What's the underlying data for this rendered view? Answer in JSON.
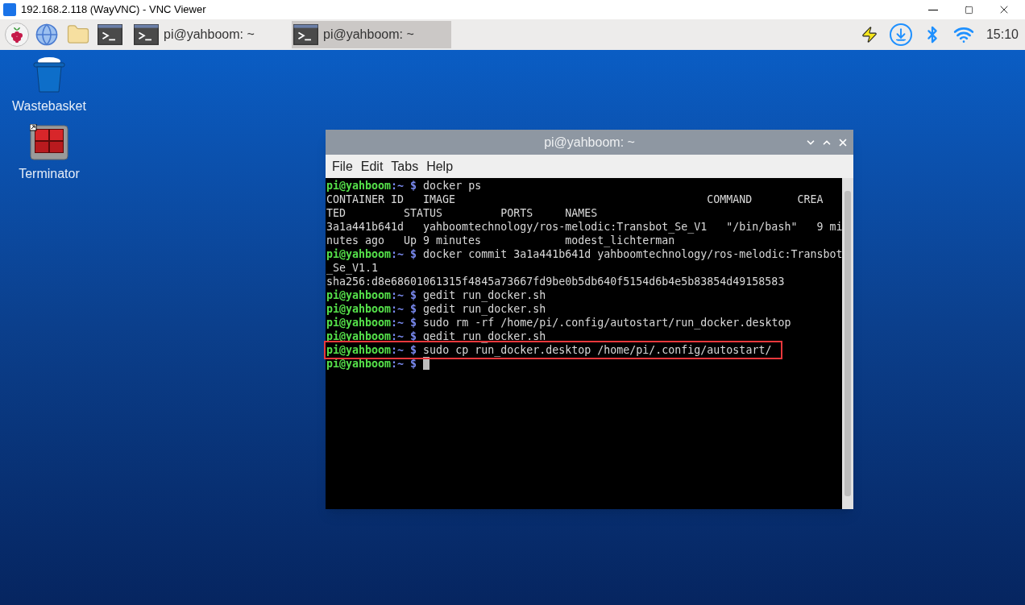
{
  "viewer": {
    "title": "192.168.2.118 (WayVNC) - VNC Viewer"
  },
  "taskbar": {
    "launchers": [
      {
        "kind": "raspberry"
      },
      {
        "kind": "globe"
      },
      {
        "kind": "folder"
      },
      {
        "kind": "terminal"
      }
    ],
    "windows": [
      {
        "label": "pi@yahboom: ~",
        "selected": false
      },
      {
        "label": "pi@yahboom: ~",
        "selected": true
      }
    ],
    "clock": "15:10"
  },
  "desktop_icons": [
    {
      "kind": "wastebasket",
      "label": "Wastebasket"
    },
    {
      "kind": "terminator",
      "label": "Terminator"
    }
  ],
  "terminal": {
    "title": "pi@yahboom: ~",
    "menu": [
      "File",
      "Edit",
      "Tabs",
      "Help"
    ],
    "lines": [
      {
        "kind": "prompt",
        "user": "pi@yahboom",
        "path": ":~",
        "symbol": "$",
        "command": "docker ps",
        "highlighted": false,
        "cursor": false
      },
      {
        "kind": "output",
        "text": "CONTAINER ID   IMAGE                                       COMMAND       CREA",
        "highlighted": false,
        "cursor": false
      },
      {
        "kind": "output",
        "text": "TED         STATUS         PORTS     NAMES",
        "highlighted": false,
        "cursor": false
      },
      {
        "kind": "output",
        "text": "3a1a441b641d   yahboomtechnology/ros-melodic:Transbot_Se_V1   \"/bin/bash\"   9 mi",
        "highlighted": false,
        "cursor": false
      },
      {
        "kind": "output",
        "text": "nutes ago   Up 9 minutes             modest_lichterman",
        "highlighted": false,
        "cursor": false
      },
      {
        "kind": "prompt",
        "user": "pi@yahboom",
        "path": ":~",
        "symbol": "$",
        "command": "docker commit 3a1a441b641d yahboomtechnology/ros-melodic:Transbot",
        "highlighted": false,
        "cursor": false
      },
      {
        "kind": "output",
        "text": "_Se_V1.1",
        "highlighted": false,
        "cursor": false
      },
      {
        "kind": "output",
        "text": "sha256:d8e68601061315f4845a73667fd9be0b5db640f5154d6b4e5b83854d49158583",
        "highlighted": false,
        "cursor": false
      },
      {
        "kind": "prompt",
        "user": "pi@yahboom",
        "path": ":~",
        "symbol": "$",
        "command": "gedit run_docker.sh",
        "highlighted": false,
        "cursor": false
      },
      {
        "kind": "prompt",
        "user": "pi@yahboom",
        "path": ":~",
        "symbol": "$",
        "command": "gedit run_docker.sh",
        "highlighted": false,
        "cursor": false
      },
      {
        "kind": "prompt",
        "user": "pi@yahboom",
        "path": ":~",
        "symbol": "$",
        "command": "sudo rm -rf /home/pi/.config/autostart/run_docker.desktop",
        "highlighted": false,
        "cursor": false
      },
      {
        "kind": "prompt",
        "user": "pi@yahboom",
        "path": ":~",
        "symbol": "$",
        "command": "gedit run_docker.sh",
        "highlighted": false,
        "cursor": false
      },
      {
        "kind": "prompt",
        "user": "pi@yahboom",
        "path": ":~",
        "symbol": "$",
        "command": "sudo cp run_docker.desktop /home/pi/.config/autostart/",
        "highlighted": true,
        "cursor": false
      },
      {
        "kind": "prompt",
        "user": "pi@yahboom",
        "path": ":~",
        "symbol": "$",
        "highlighted": false,
        "cursor": true
      }
    ]
  }
}
